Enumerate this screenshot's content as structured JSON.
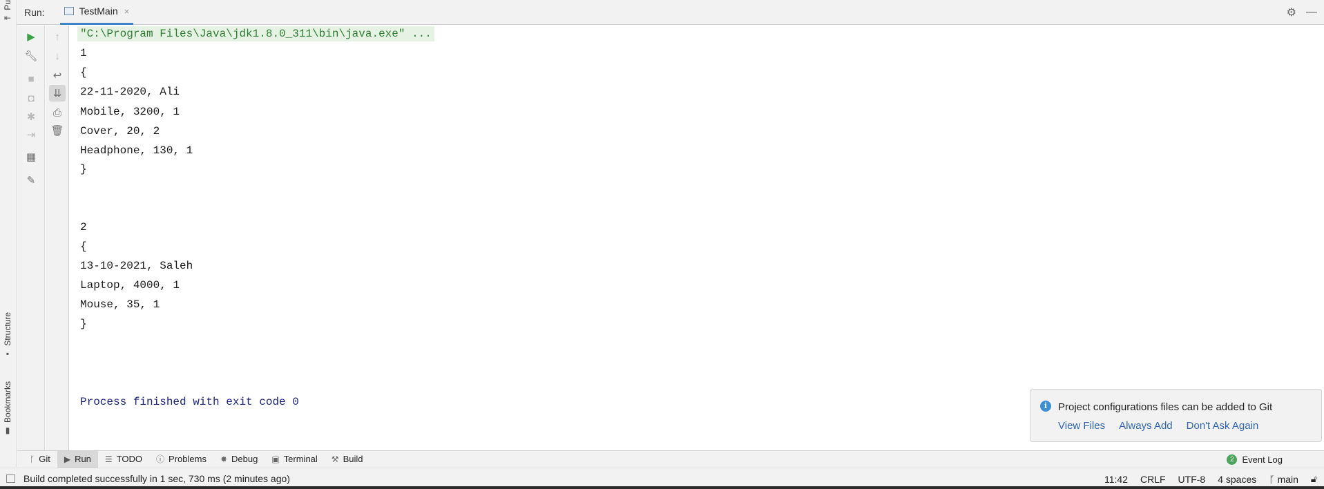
{
  "left_strip": {
    "top_tab": "Pu",
    "structure": "Structure",
    "bookmarks": "Bookmarks"
  },
  "run_window": {
    "label": "Run:",
    "tab_title": "TestMain",
    "close_glyph": "×"
  },
  "console": {
    "lines": [
      "\"C:\\Program Files\\Java\\jdk1.8.0_311\\bin\\java.exe\" ...",
      "1",
      "{",
      "22-11-2020, Ali",
      "Mobile, 3200, 1",
      "Cover, 20, 2",
      "Headphone, 130, 1",
      "}",
      "2",
      "{",
      "13-10-2021, Saleh",
      "Laptop, 4000, 1",
      "Mouse, 35, 1",
      "}",
      "Process finished with exit code 0"
    ]
  },
  "notification": {
    "message": "Project configurations files can be added to Git",
    "links": [
      "View Files",
      "Always Add",
      "Don't Ask Again"
    ]
  },
  "bottom_tabs": [
    {
      "label": "Git",
      "icon": "git-branch-icon"
    },
    {
      "label": "Run",
      "icon": "run-icon"
    },
    {
      "label": "TODO",
      "icon": "list-icon"
    },
    {
      "label": "Problems",
      "icon": "info-icon"
    },
    {
      "label": "Debug",
      "icon": "bug-icon"
    },
    {
      "label": "Terminal",
      "icon": "terminal-icon"
    },
    {
      "label": "Build",
      "icon": "hammer-icon"
    }
  ],
  "event_log": {
    "count": "2",
    "label": "Event Log"
  },
  "status": {
    "message": "Build completed successfully in 1 sec, 730 ms (2 minutes ago)",
    "time": "11:42",
    "line_sep": "CRLF",
    "encoding": "UTF-8",
    "indent": "4 spaces",
    "branch": "main"
  },
  "colors": {
    "accent": "#4083c9",
    "run_green": "#3aa34a",
    "link": "#2f66b3",
    "exit_text": "#1a237e"
  }
}
